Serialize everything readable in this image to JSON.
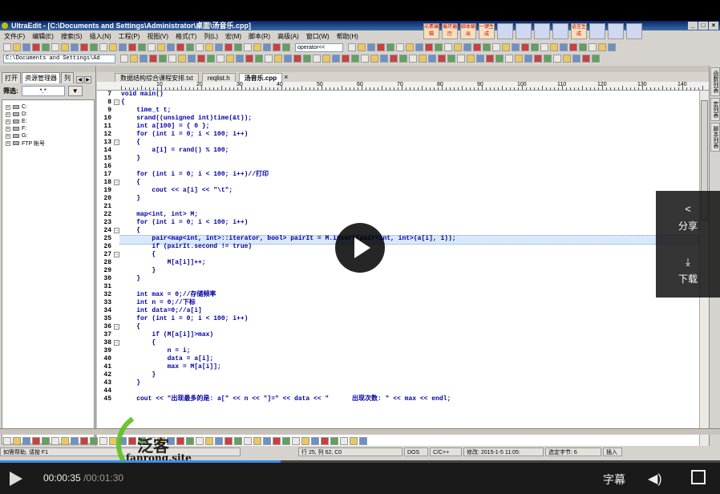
{
  "window": {
    "title": "UltraEdit - [C:\\Documents and Settings\\Administrator\\桌面\\汤音乐.cpp]"
  },
  "menu": [
    "文件(F)",
    "编辑(E)",
    "搜索(S)",
    "插入(N)",
    "工程(P)",
    "视图(V)",
    "格式(T)",
    "列(L)",
    "宏(M)",
    "脚本(R)",
    "高级(A)",
    "窗口(W)",
    "帮助(H)"
  ],
  "big_tools": [
    "元素编辑",
    "循环遍历",
    "脚本输出",
    "一键生成",
    "",
    "",
    "",
    "",
    "语言生成",
    "",
    "",
    ""
  ],
  "toolbar": {
    "function_select": "operator<<",
    "path_box": "C:\\Documents and Settings\\Ad"
  },
  "left_panel": {
    "tabs": [
      "打开",
      "资源管理器",
      "列"
    ],
    "filter_label": "筛选:",
    "filter_value": "*.*",
    "filter_button": "▼",
    "tree": [
      "C:",
      "D:",
      "E:",
      "F:",
      "G:",
      "FTP 帐号"
    ]
  },
  "file_tabs": [
    {
      "label": "数据结构综合课程安排.txt",
      "active": false
    },
    {
      "label": "reqlist.h",
      "active": false
    },
    {
      "label": "汤音乐.cpp",
      "active": true
    }
  ],
  "ruler": [
    "10",
    "20",
    "30",
    "40",
    "50",
    "60",
    "70",
    "80",
    "90",
    "100",
    "110",
    "120",
    "130",
    "140"
  ],
  "code_lines": [
    {
      "n": "7",
      "t": "void main()"
    },
    {
      "n": "8",
      "t": "{"
    },
    {
      "n": "9",
      "t": "    time_t t;"
    },
    {
      "n": "10",
      "t": "    srand((unsigned int)time(&t));"
    },
    {
      "n": "11",
      "t": "    int a[100] = { 0 };"
    },
    {
      "n": "12",
      "t": "    for (int i = 0; i < 100; i++)"
    },
    {
      "n": "13",
      "t": "    {"
    },
    {
      "n": "14",
      "t": "        a[i] = rand() % 100;"
    },
    {
      "n": "15",
      "t": "    }"
    },
    {
      "n": "16",
      "t": ""
    },
    {
      "n": "17",
      "t": "    for (int i = 0; i < 100; i++)//打印"
    },
    {
      "n": "18",
      "t": "    {"
    },
    {
      "n": "19",
      "t": "        cout << a[i] << \"\\t\";"
    },
    {
      "n": "20",
      "t": "    }"
    },
    {
      "n": "21",
      "t": ""
    },
    {
      "n": "22",
      "t": "    map<int, int> M;"
    },
    {
      "n": "23",
      "t": "    for (int i = 0; i < 100; i++)"
    },
    {
      "n": "24",
      "t": "    {"
    },
    {
      "n": "25",
      "t": "        pair<map<int, int>::iterator, bool> pairIt = M.insert(pair<int, int>(a[i], 1));"
    },
    {
      "n": "26",
      "t": "        if (pairIt.second != true)"
    },
    {
      "n": "27",
      "t": "        {"
    },
    {
      "n": "28",
      "t": "            M[a[i]]++;"
    },
    {
      "n": "29",
      "t": "        }"
    },
    {
      "n": "30",
      "t": "    }"
    },
    {
      "n": "31",
      "t": ""
    },
    {
      "n": "32",
      "t": "    int max = 0;//存储频率"
    },
    {
      "n": "33",
      "t": "    int n = 0;//下标"
    },
    {
      "n": "34",
      "t": "    int data=0;//a[i]"
    },
    {
      "n": "35",
      "t": "    for (int i = 0; i < 100; i++)"
    },
    {
      "n": "36",
      "t": "    {"
    },
    {
      "n": "37",
      "t": "        if (M[a[i]]>max)"
    },
    {
      "n": "38",
      "t": "        {"
    },
    {
      "n": "39",
      "t": "            n = i;"
    },
    {
      "n": "40",
      "t": "            data = a[i];"
    },
    {
      "n": "41",
      "t": "            max = M[a[i]];"
    },
    {
      "n": "42",
      "t": "        }"
    },
    {
      "n": "43",
      "t": "    }"
    },
    {
      "n": "44",
      "t": ""
    },
    {
      "n": "45",
      "t": "    cout << \"出现最多的是: a[\" << n << \"]=\" << data << \"      出现次数: \" << max << endl;"
    }
  ],
  "right_tabs": [
    "函数列表",
    "宏列表",
    "脚本列表"
  ],
  "status": {
    "help": "如需帮助, 请按 F1",
    "position": "行 25, 列 62, C0",
    "eol": "DOS",
    "lang": "C/C++",
    "modified": "修改: 2015-1-5 11:05:",
    "selection": "选定字节: 6",
    "mode": "插入"
  },
  "overlay": {
    "share_label": "分享",
    "download_label": "下载",
    "watermark_brand": "泛客",
    "watermark_site": "fanrong.site"
  },
  "player": {
    "current_time": "00:00:35",
    "duration": "/00:01:30",
    "progress": 0.39,
    "subtitle_label": "字幕"
  }
}
